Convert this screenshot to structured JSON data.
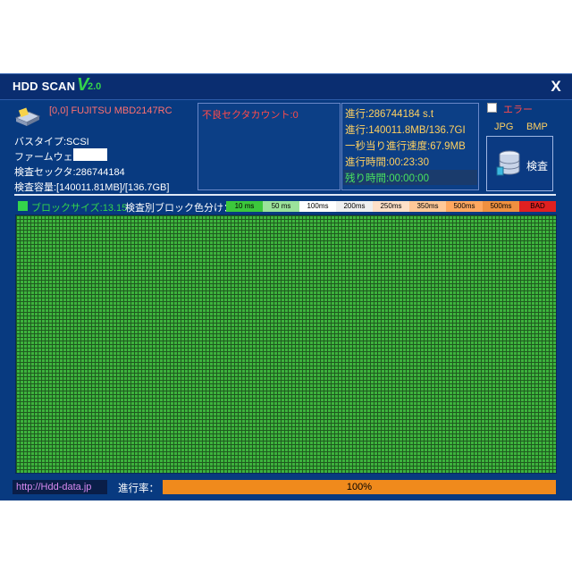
{
  "window": {
    "title": "HDD SCAN",
    "title_v": "V",
    "version": "2.0",
    "close_label": "X"
  },
  "drive": {
    "title": "[0,0] FUJITSU MBD2147RC",
    "bus_type": "バスタイプ:SCSI",
    "firmware_label": "ファームウェア:",
    "firmware_value": "",
    "sectors": "検査セックタ:286744184",
    "capacity": "検査容量:[140011.81MB]/[136.7GB]"
  },
  "bad_sectors": {
    "label": "不良セクタカウント:0"
  },
  "stats": {
    "progress_sectors": "進行:286744184 s.t",
    "progress_capacity": "進行:140011.8MB/136.7GI",
    "speed": "一秒当り進行速度:67.9MB",
    "elapsed": "進行時間:00:23:30",
    "remaining": "残り時間:00:00:00"
  },
  "options": {
    "error_label": "エラー",
    "error_checked": false,
    "jpg_label": "JPG",
    "bmp_label": "BMP",
    "scan_button_label": "検査"
  },
  "legend": {
    "block_size": "ブロックサイズ:13.15",
    "title": "検査別ブロック色分け：",
    "items": [
      {
        "label": "10 ms",
        "color": "#3cc83c"
      },
      {
        "label": "50 ms",
        "color": "#9be29b"
      },
      {
        "label": "100ms",
        "color": "#ffffff"
      },
      {
        "label": "200ms",
        "color": "#f0f0f0"
      },
      {
        "label": "250ms",
        "color": "#ffe0c8"
      },
      {
        "label": "350ms",
        "color": "#ffc898"
      },
      {
        "label": "500ms",
        "color": "#ffa860"
      },
      {
        "label": "500ms",
        "color": "#f09040"
      },
      {
        "label": "BAD",
        "color": "#e02020"
      }
    ]
  },
  "grid": {
    "block_color": "#3db33d",
    "line_color": "#1f5a1f"
  },
  "footer": {
    "url": "http://Hdd-data.jp",
    "progress_label": "進行率：",
    "progress_text": "100%",
    "progress_value": 1.0
  },
  "colors": {
    "background": "#083a80",
    "accent_green": "#34d44b",
    "stat_text": "#ffd060",
    "error_red": "#ff4a4a",
    "progress_orange": "#f08a1c"
  }
}
